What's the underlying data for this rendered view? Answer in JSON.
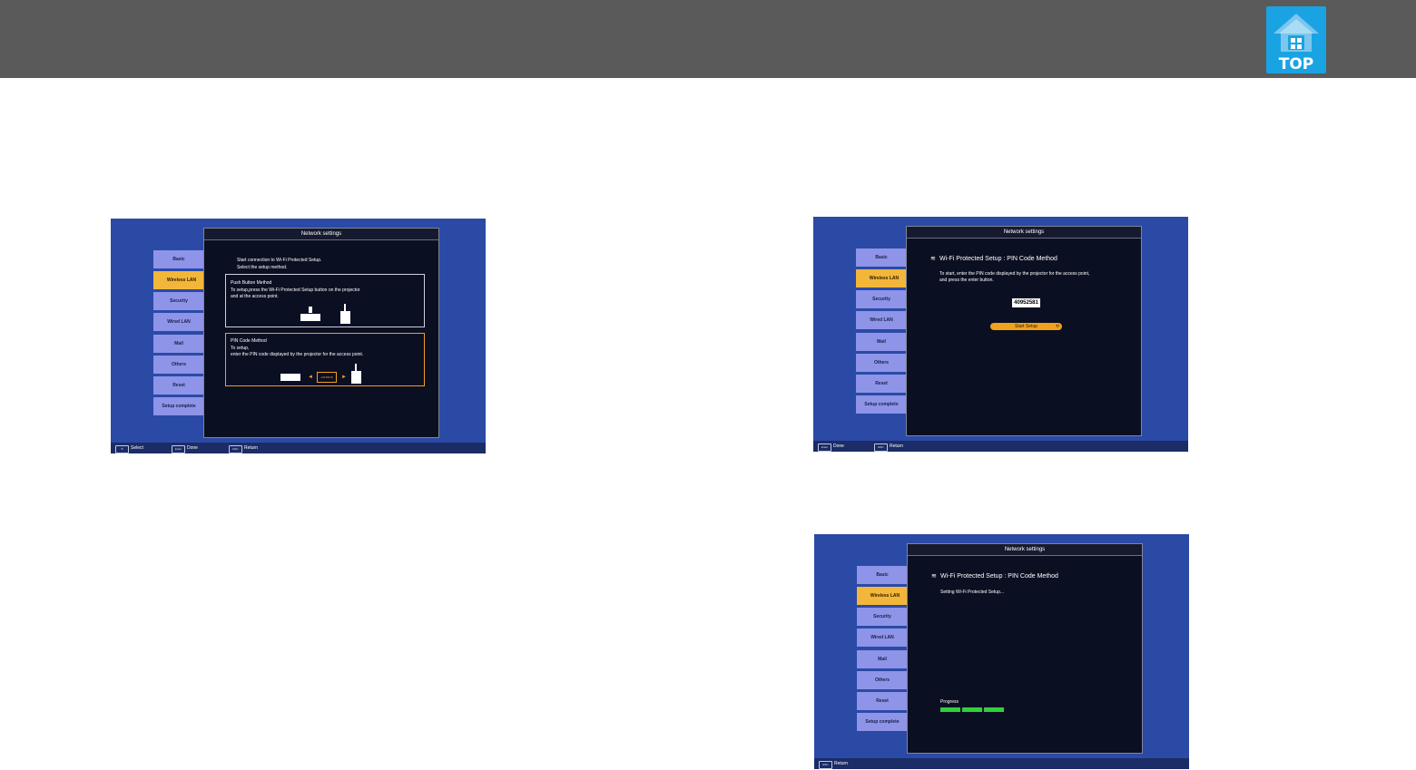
{
  "header": {
    "top_label": "TOP"
  },
  "shots": [
    {
      "panel_title": "Network settings",
      "menu": [
        "Basic",
        "Wireless LAN",
        "Security",
        "Wired LAN",
        "Mail",
        "Others",
        "Reset",
        "Setup complete"
      ],
      "active_index": 1,
      "intro_line1": "Start connection to Wi-Fi Protected Setup.",
      "intro_line2": "Select the setup method.",
      "push_title": "Push Button Method",
      "push_line1": "To setup,press the Wi-Fi Protected Setup button on the projector",
      "push_line2": "and at the access point.",
      "pin_title": "PIN Code Method",
      "pin_line1": "To setup,",
      "pin_line2": "enter the PIN code displayed by the projector for the access point.",
      "pin_sample": "12345678",
      "footer": [
        {
          "key": "✣",
          "label": "Select"
        },
        {
          "key": "Enter",
          "label": "Done"
        },
        {
          "key": "ESC",
          "label": "Return"
        }
      ]
    },
    {
      "panel_title": "Network settings",
      "menu": [
        "Basic",
        "Wireless LAN",
        "Security",
        "Wired LAN",
        "Mail",
        "Others",
        "Reset",
        "Setup complete"
      ],
      "active_index": 1,
      "heading": "Wi-Fi Protected Setup : PIN Code Method",
      "line1": "To start, enter the PIN code displayed by the projector for the access point,",
      "line2": "and press the enter button.",
      "pin_code": "40952581",
      "start_button": "Start Setup",
      "footer": [
        {
          "key": "Enter",
          "label": "Done"
        },
        {
          "key": "ESC",
          "label": "Return"
        }
      ]
    },
    {
      "panel_title": "Network settings",
      "menu": [
        "Basic",
        "Wireless LAN",
        "Security",
        "Wired LAN",
        "Mail",
        "Others",
        "Reset",
        "Setup complete"
      ],
      "active_index": 1,
      "heading": "Wi-Fi Protected Setup : PIN Code Method",
      "status": "Setting Wi-Fi Protected Setup...",
      "progress_label": "Progress",
      "progress_fraction": 0.3,
      "footer": [
        {
          "key": "ESC",
          "label": "Return"
        }
      ]
    }
  ]
}
